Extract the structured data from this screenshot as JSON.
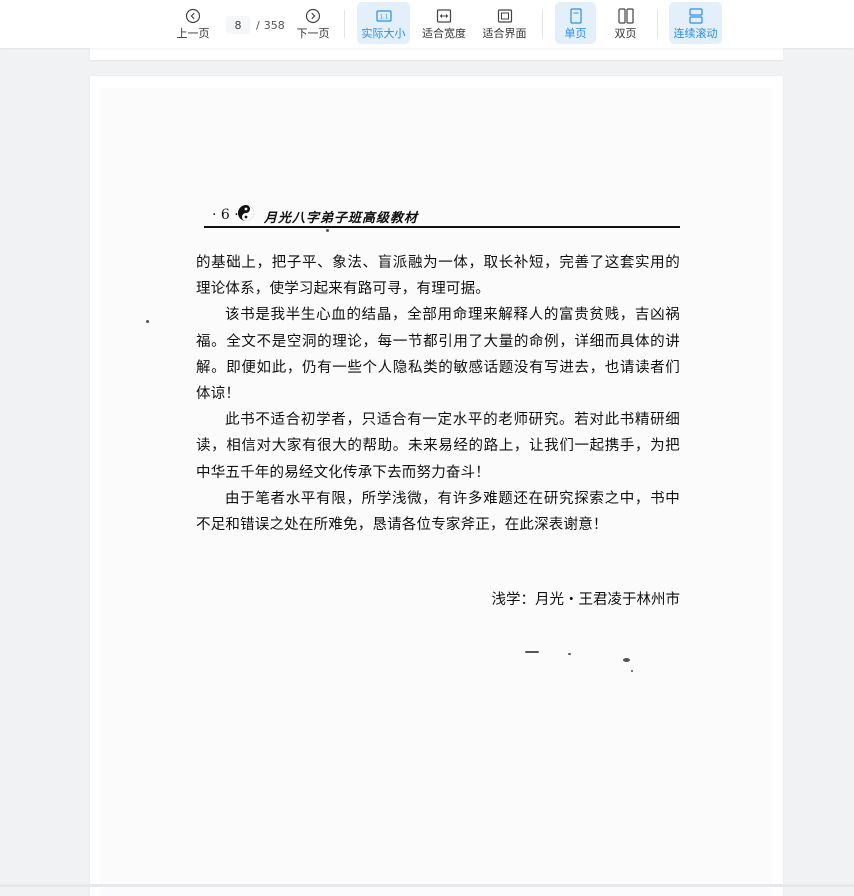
{
  "toolbar": {
    "prev_label": "上一页",
    "next_label": "下一页",
    "current_page": "8",
    "page_separator": "/",
    "total_pages": "358",
    "actual_size_label": "实际大小",
    "fit_width_label": "适合宽度",
    "fit_page_label": "适合界面",
    "single_page_label": "单页",
    "double_page_label": "双页",
    "continuous_label": "连续滚动",
    "accent_color": "#2b8ce3"
  },
  "page": {
    "header": {
      "page_number": "· 6 ·",
      "title": "月光八字弟子班高级教材"
    },
    "paragraphs": [
      {
        "text": "的基础上，把子平、象法、盲派融为一体，取长补短，完善了这套实用的理论体系，使学习起来有路可寻，有理可据。",
        "indent": false
      },
      {
        "text": "该书是我半生心血的结晶，全部用命理来解释人的富贵贫贱，吉凶祸福。全文不是空洞的理论，每一节都引用了大量的命例，详细而具体的讲解。即便如此，仍有一些个人隐私类的敏感话题没有写进去，也请读者们体谅！",
        "indent": true
      },
      {
        "text": "此书不适合初学者，只适合有一定水平的老师研究。若对此书精研细读，相信对大家有很大的帮助。未来易经的路上，让我们一起携手，为把中华五千年的易经文化传承下去而努力奋斗！",
        "indent": true
      },
      {
        "text": "由于笔者水平有限，所学浅微，有许多难题还在研究探索之中，书中不足和错误之处在所难免，恳请各位专家斧正，在此深表谢意！",
        "indent": true
      }
    ],
    "signature": "浅学：月光・王君凌于林州市"
  }
}
